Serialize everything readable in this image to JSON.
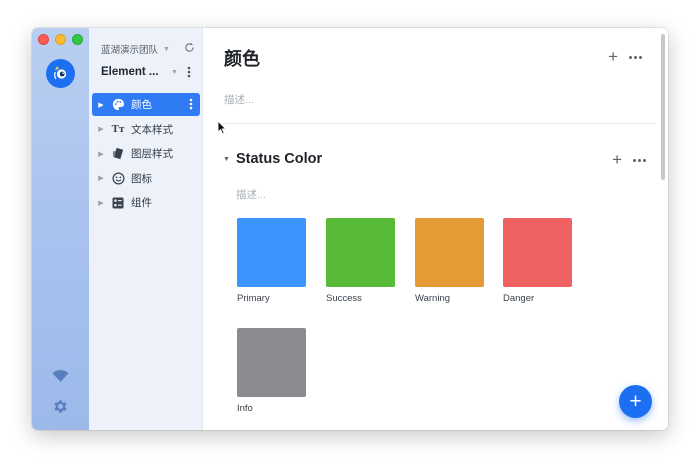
{
  "window": {
    "traffic_lights": [
      "close",
      "minimize",
      "zoom"
    ]
  },
  "rail": {
    "logo_icon": "owl-logo-icon",
    "bottom_icons": [
      "wifi-icon",
      "settings-gear-icon"
    ]
  },
  "sidebar": {
    "team_name": "蓝湖演示团队",
    "project_name": "Element ...",
    "items": [
      {
        "label": "颜色",
        "icon": "palette-icon",
        "active": true
      },
      {
        "label": "文本样式",
        "icon": "text-style-icon",
        "active": false
      },
      {
        "label": "图层样式",
        "icon": "layer-style-icon",
        "active": false
      },
      {
        "label": "图标",
        "icon": "smiley-icon",
        "active": false
      },
      {
        "label": "组件",
        "icon": "component-icon",
        "active": false
      }
    ]
  },
  "main": {
    "title": "颜色",
    "description_placeholder": "描述...",
    "group": {
      "title": "Status Color",
      "description_placeholder": "描述...",
      "swatches": [
        {
          "label": "Primary",
          "color": "#3a95fc"
        },
        {
          "label": "Success",
          "color": "#57bb37"
        },
        {
          "label": "Warning",
          "color": "#e49a35"
        },
        {
          "label": "Danger",
          "color": "#f06262"
        },
        {
          "label": "Info",
          "color": "#898b8f"
        }
      ]
    },
    "fab_label": "+"
  },
  "colors": {
    "accent": "#2f7bf3",
    "rail": "#a9c2ee",
    "sidebar_bg": "#edf1f9"
  }
}
